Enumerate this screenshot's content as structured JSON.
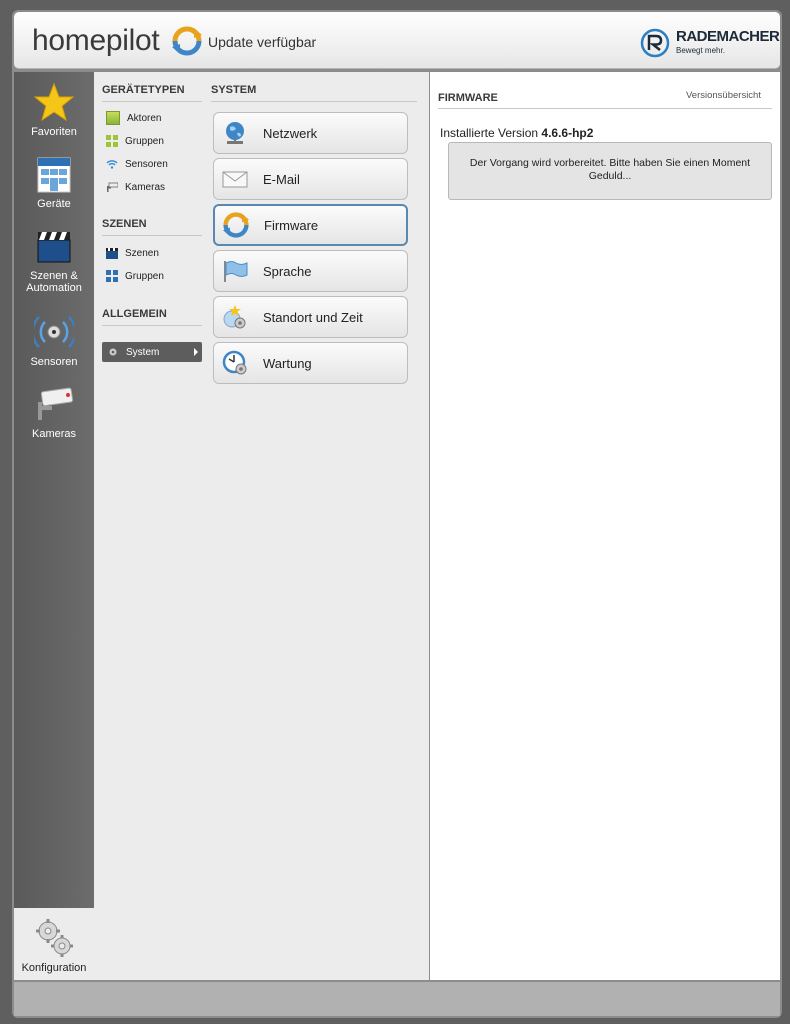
{
  "header": {
    "app_name": "homepilot",
    "update_text": "Update verfügbar",
    "brand_name": "RADEMACHER",
    "brand_slogan": "Bewegt mehr."
  },
  "left_nav": {
    "items": [
      {
        "label": "Favoriten",
        "icon": "star-icon"
      },
      {
        "label": "Geräte",
        "icon": "building-icon"
      },
      {
        "label": "Szenen &\nAutomation",
        "icon": "clapperboard-icon"
      },
      {
        "label": "Sensoren",
        "icon": "sensor-wave-icon"
      },
      {
        "label": "Kameras",
        "icon": "camera-icon"
      }
    ],
    "config_label": "Konfiguration"
  },
  "categories": {
    "geraetetypen_title": "GERÄTETYPEN",
    "geraetetypen": [
      {
        "label": "Aktoren",
        "icon": "actor-icon"
      },
      {
        "label": "Gruppen",
        "icon": "groups-icon"
      },
      {
        "label": "Sensoren",
        "icon": "wifi-icon"
      },
      {
        "label": "Kameras",
        "icon": "camera-icon"
      }
    ],
    "szenen_title": "SZENEN",
    "szenen": [
      {
        "label": "Szenen",
        "icon": "clapperboard-icon"
      },
      {
        "label": "Gruppen",
        "icon": "groups-icon"
      }
    ],
    "allgemein_title": "ALLGEMEIN",
    "allgemein_selected": "System"
  },
  "system": {
    "title": "SYSTEM",
    "buttons": [
      {
        "label": "Netzwerk",
        "icon": "globe-icon"
      },
      {
        "label": "E-Mail",
        "icon": "envelope-icon"
      },
      {
        "label": "Firmware",
        "icon": "update-icon",
        "active": true
      },
      {
        "label": "Sprache",
        "icon": "flag-icon"
      },
      {
        "label": "Standort und Zeit",
        "icon": "location-time-icon"
      },
      {
        "label": "Wartung",
        "icon": "clock-gear-icon"
      }
    ]
  },
  "firmware": {
    "title": "FIRMWARE",
    "versions_link": "Versionsübersicht",
    "installed_label": "Installierte Version",
    "installed_version": "4.6.6-hp2",
    "message": "Der Vorgang wird vorbereitet. Bitte haben Sie einen Moment Geduld..."
  },
  "colors": {
    "accent_blue": "#5a88b0",
    "nav_bg": "#5f5f5f",
    "selected_bg": "#5d5d5d"
  }
}
